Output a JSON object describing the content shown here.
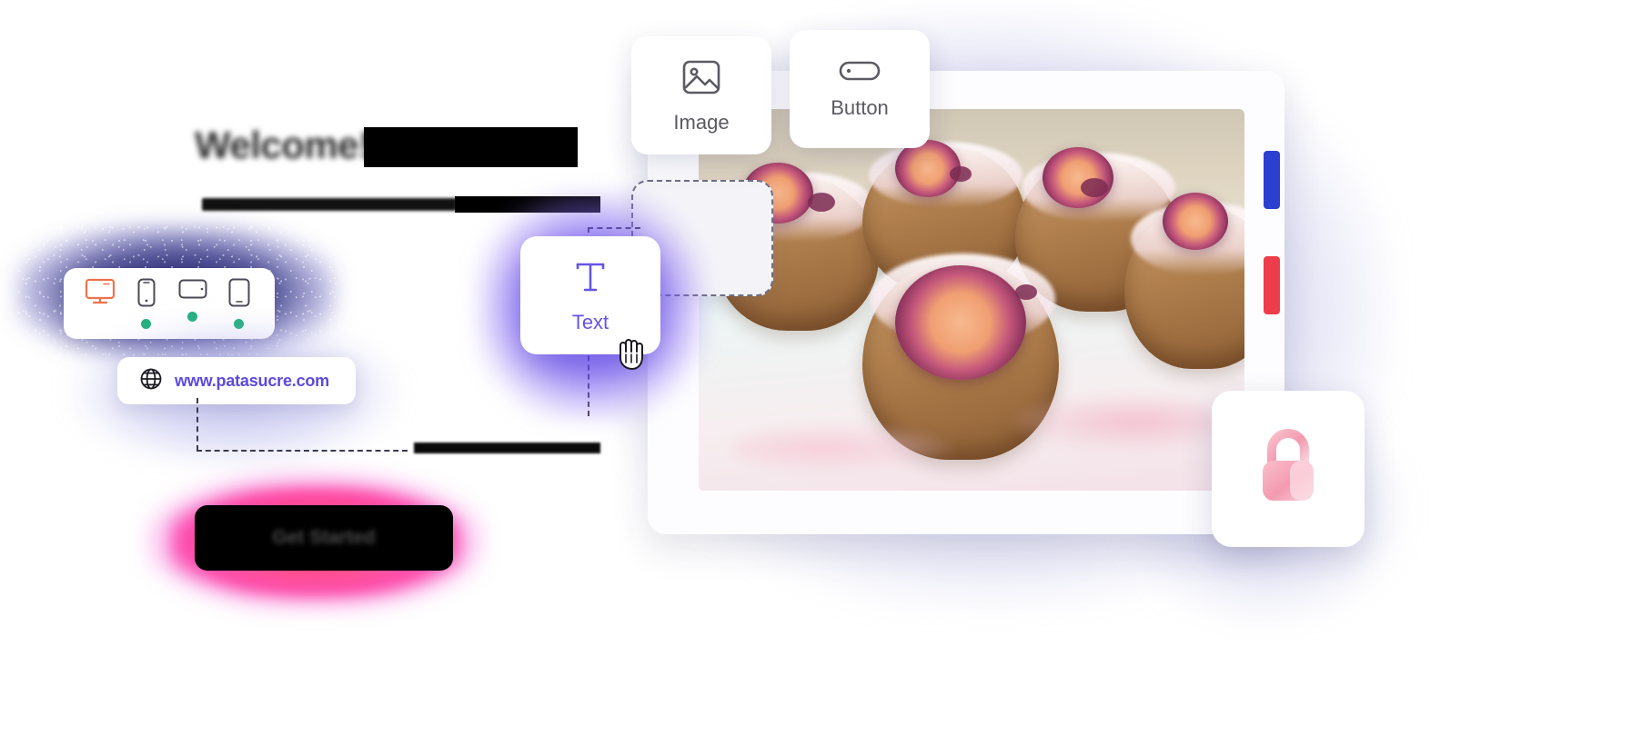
{
  "hero": {
    "headline": "Welcome!",
    "headline_blurred": true,
    "cta_label": "Get Started"
  },
  "device_bar": {
    "devices": [
      {
        "name": "desktop",
        "icon": "monitor-icon",
        "color": "#f0714a",
        "status_dot": false
      },
      {
        "name": "mobile",
        "icon": "phone-icon",
        "color": "#4a4a55",
        "status_dot": true
      },
      {
        "name": "tablet-landscape",
        "icon": "tablet-landscape-icon",
        "color": "#4a4a55",
        "status_dot": true
      },
      {
        "name": "tablet-portrait",
        "icon": "tablet-portrait-icon",
        "color": "#4a4a55",
        "status_dot": true
      }
    ],
    "dot_color": "#22b07d"
  },
  "url_bar": {
    "icon": "globe-icon",
    "url": "www.patasucre.com",
    "url_color": "#5b4ae0"
  },
  "widgets": [
    {
      "id": "image",
      "label": "Image",
      "icon": "image-icon"
    },
    {
      "id": "button",
      "label": "Button",
      "icon": "button-pill-icon"
    },
    {
      "id": "text",
      "label": "Text",
      "icon": "text-t-icon"
    }
  ],
  "canvas": {
    "photo_alt": "croissants with figs and icing",
    "drop_zone": "empty-drop-placeholder",
    "cursor": "grab-hand-cursor"
  },
  "chrome_bars": [
    {
      "name": "bar-blue",
      "color": "#2b3fd0"
    },
    {
      "name": "bar-red",
      "color": "#ee3d4a"
    }
  ],
  "lock_card": {
    "icon": "lock-icon",
    "color": "#f49ab0"
  },
  "accents": {
    "purple": "#6655e2",
    "orange": "#f0714a",
    "green": "#22b07d",
    "pink_glow": "#ff0082",
    "blue_glow": "#1a1a78"
  }
}
